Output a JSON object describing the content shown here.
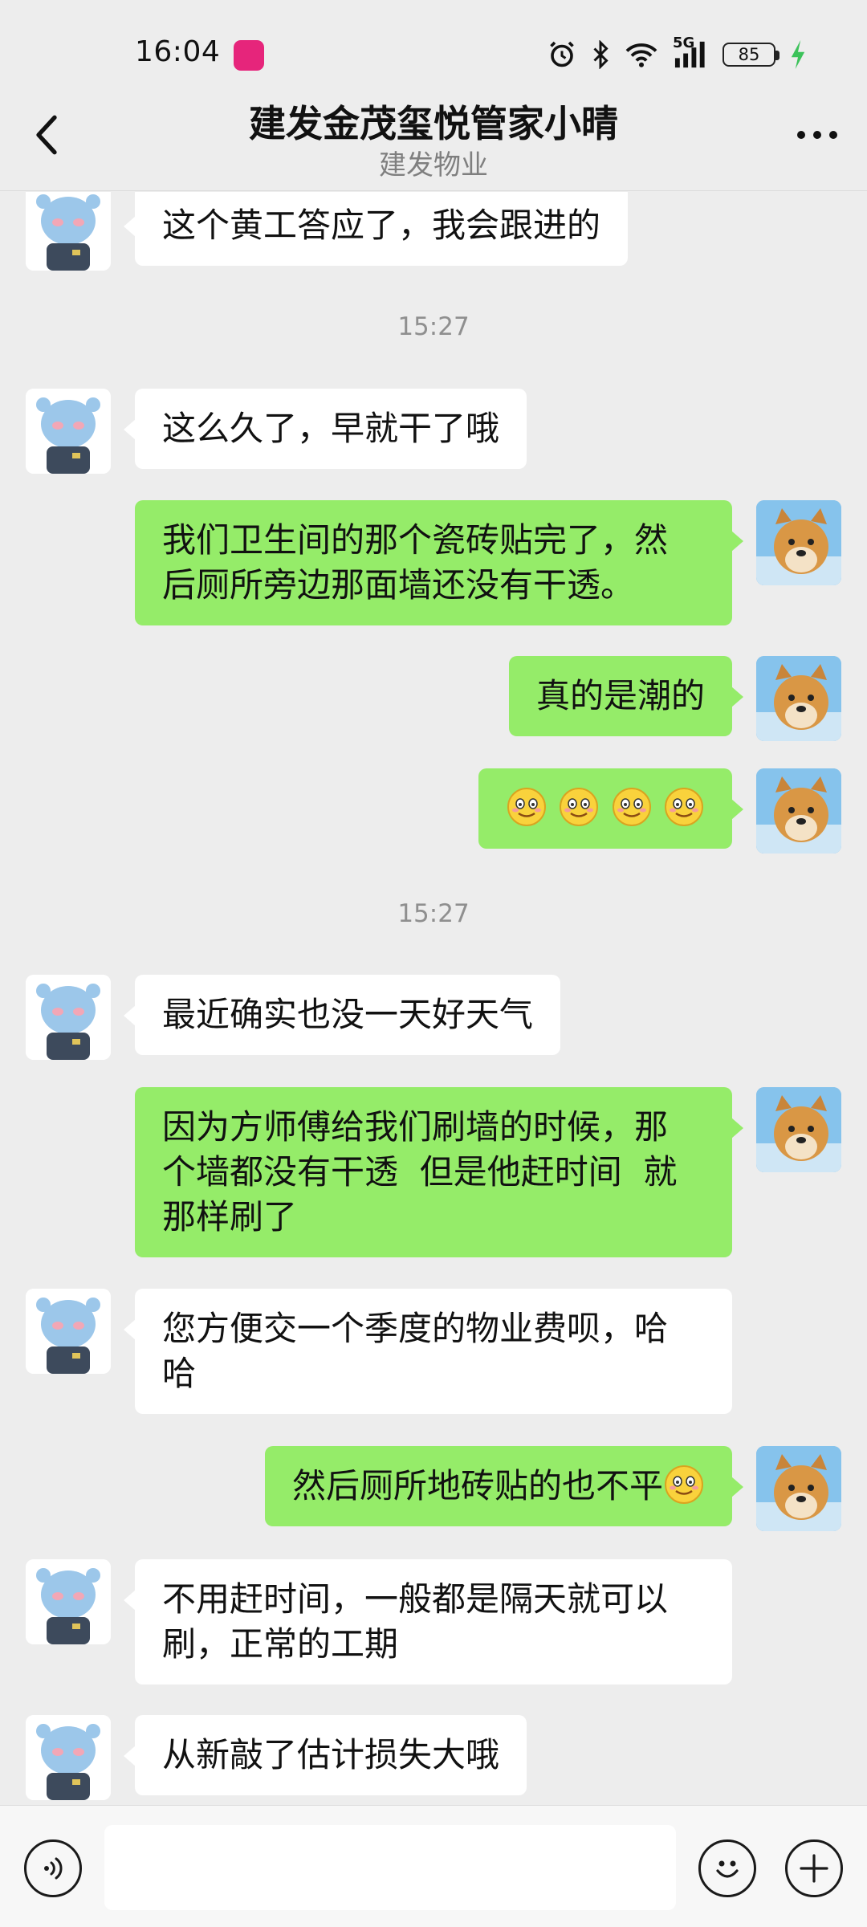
{
  "status_bar": {
    "time": "16:04",
    "network": "5G",
    "battery": "85"
  },
  "header": {
    "title": "建发金茂玺悦管家小晴",
    "subtitle": "建发物业"
  },
  "messages": [
    {
      "side": "left",
      "text": "这个黄工答应了，我会跟进的"
    },
    {
      "type": "time",
      "text": "15:27"
    },
    {
      "side": "left",
      "text": "这么久了，早就干了哦"
    },
    {
      "side": "right",
      "line1": "我们卫生间的那个瓷砖贴完了，然",
      "line2": "后厕所旁边那面墙还没有干透。"
    },
    {
      "side": "right",
      "text": "真的是潮的"
    },
    {
      "side": "right",
      "emoji": "smile-emoji",
      "count": 4
    },
    {
      "type": "time",
      "text": "15:27"
    },
    {
      "side": "left",
      "text": "最近确实也没一天好天气"
    },
    {
      "side": "right",
      "line1": "因为方师傅给我们刷墙的时候，那",
      "line2": "个墙都没有干透  但是他赶时间  就",
      "line3": "那样刷了"
    },
    {
      "side": "left",
      "line1": "您方便交一个季度的物业费呗，哈",
      "line2": "哈"
    },
    {
      "side": "right",
      "text": "然后厕所地砖贴的也不平",
      "emoji": "smile-emoji"
    },
    {
      "side": "left",
      "line1": "不用赶时间，一般都是隔天就可以",
      "line2": "刷，正常的工期"
    },
    {
      "side": "left",
      "text": "从新敲了估计损失大哦"
    }
  ],
  "input": {
    "value": ""
  },
  "colors": {
    "background": "#ededed",
    "bubble_self": "#95ec69",
    "bubble_other": "#ffffff",
    "timestamp": "#8f8f8f"
  }
}
